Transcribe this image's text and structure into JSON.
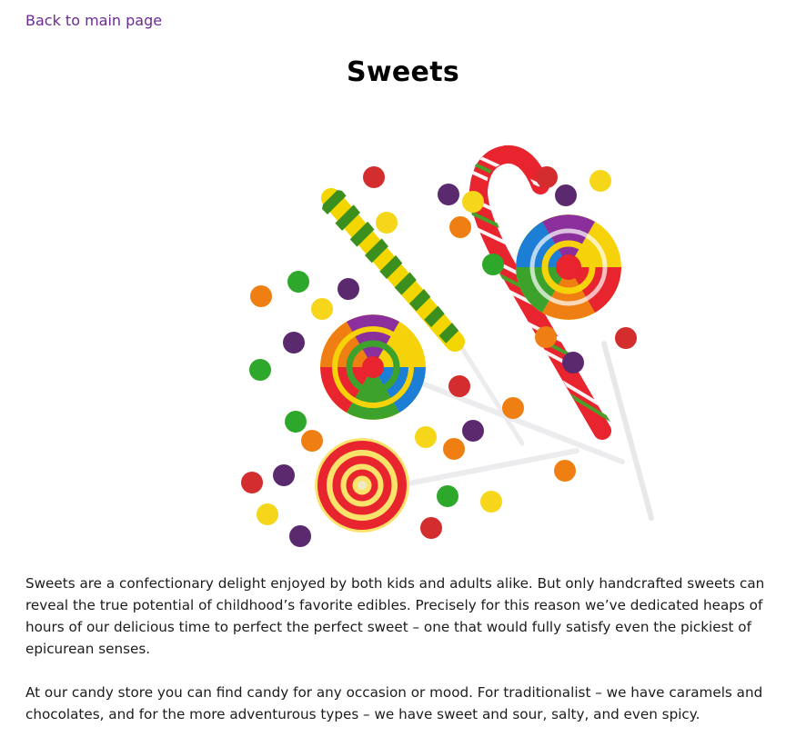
{
  "nav": {
    "back_label": "Back to main page"
  },
  "page": {
    "title": "Sweets"
  },
  "content": {
    "paragraphs": [
      "Sweets are a confectionary delight enjoyed by both kids and adults alike. But only handcrafted sweets can reveal the true potential of childhood’s favorite edibles. Precisely for this reason we’ve dedicated heaps of hours of our delicious time to perfect the perfect sweet – one that would fully satisfy even the pickiest of epicurean senses.",
      "At our candy store you can find candy for any occasion or mood. For traditionalist – we have caramels and chocolates, and for the more adventurous types – we have sweet and sour, salty, and even spicy."
    ]
  },
  "colors": {
    "link": "#6a2c91",
    "title": "#000000",
    "body_text": "#1c1c1c"
  }
}
